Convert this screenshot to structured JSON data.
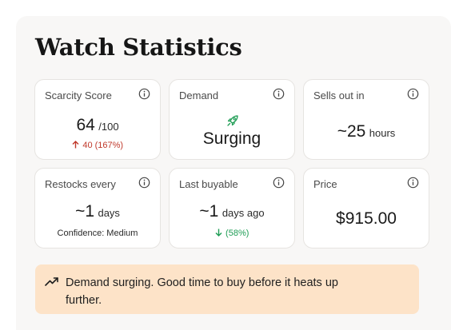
{
  "title": "Watch Statistics",
  "cards": {
    "scarcity": {
      "label": "Scarcity Score",
      "value": "64",
      "unit": "/100",
      "delta": "40 (167%)",
      "delta_direction": "up"
    },
    "demand": {
      "label": "Demand",
      "value": "Surging",
      "icon": "rocket-icon"
    },
    "sells_out": {
      "label": "Sells out in",
      "prefix": "~",
      "value": "25",
      "unit": "hours"
    },
    "restocks": {
      "label": "Restocks every",
      "prefix": "~",
      "value": "1",
      "unit": "days",
      "confidence": "Confidence: Medium"
    },
    "last_buyable": {
      "label": "Last buyable",
      "prefix": "~",
      "value": "1",
      "unit": "days ago",
      "delta": "(58%)",
      "delta_direction": "down"
    },
    "price": {
      "label": "Price",
      "value": "$915.00"
    }
  },
  "banner": {
    "icon": "trending-up-icon",
    "text": "Demand surging. Good time to buy before it heats up further."
  },
  "colors": {
    "panel_bg": "#f8f7f6",
    "banner_bg": "#fde3c8",
    "delta_up": "#c0392b",
    "delta_down": "#1f9d55",
    "rocket": "#1f9d55"
  }
}
